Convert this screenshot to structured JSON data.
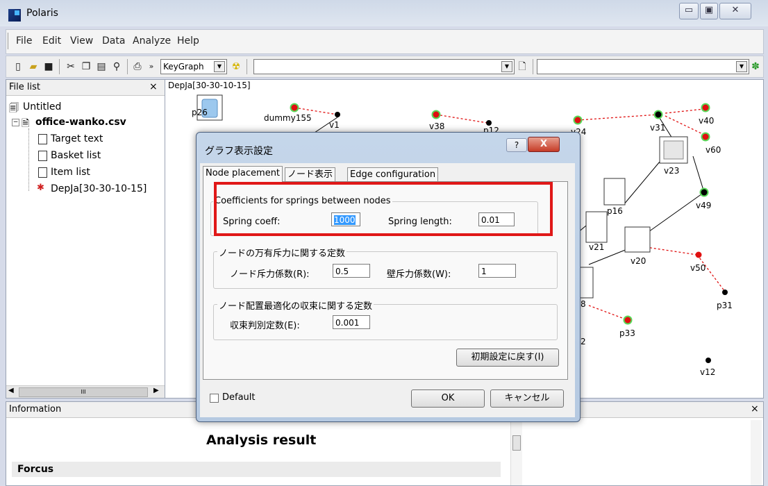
{
  "window": {
    "title": "Polaris"
  },
  "menu": [
    "File",
    "Edit",
    "View",
    "Data",
    "Analyze",
    "Help"
  ],
  "toolbar": {
    "mode_select": "KeyGraph",
    "chevron": "»"
  },
  "file_list": {
    "header": "File list",
    "close": "×",
    "items": [
      {
        "label": "Untitled",
        "bold": false
      },
      {
        "label": "office-wanko.csv",
        "bold": true
      },
      {
        "label": "Target text"
      },
      {
        "label": "Basket list"
      },
      {
        "label": "Item list"
      },
      {
        "label": "DepJa[30-30-10-15]"
      }
    ],
    "scroll_thumb": "III"
  },
  "graph": {
    "title": "DepJa[30-30-10-15]",
    "labels": [
      "p26",
      "dummy155",
      "v1",
      "v38",
      "p12",
      "v24",
      "v31",
      "v40",
      "v60",
      "v23",
      "v49",
      "p16",
      "v21",
      "v20",
      "v50",
      "p31",
      "8",
      "p33",
      "v12",
      "2"
    ]
  },
  "info": {
    "header": "Information",
    "close": "×",
    "heading": "Analysis result",
    "section": "Forcus"
  },
  "dialog": {
    "title": "グラフ表示設定",
    "help": "?",
    "close": "X",
    "tabs": [
      "Node placement",
      "ノード表示",
      "Edge configuration"
    ],
    "group1": {
      "title": "Coefficients for springs between nodes",
      "spring_coeff_label": "Spring coeff:",
      "spring_coeff": "1000",
      "spring_length_label": "Spring length:",
      "spring_length": "0.01"
    },
    "group2": {
      "title": "ノードの万有斥力に関する定数",
      "node_label": "ノード斥力係数(R):",
      "node_value": "0.5",
      "wall_label": "壁斥力係数(W):",
      "wall_value": "1"
    },
    "group3": {
      "title": "ノード配置最適化の収束に関する定数",
      "conv_label": "収束判別定数(E):",
      "conv_value": "0.001"
    },
    "reset_button": "初期設定に戻す(I)",
    "default_label": "Default",
    "ok": "OK",
    "cancel": "キャンセル"
  },
  "colors": {
    "highlight": "#e01818",
    "node_red": "#e01010",
    "node_black": "#000000",
    "node_ring": "#58d858"
  }
}
